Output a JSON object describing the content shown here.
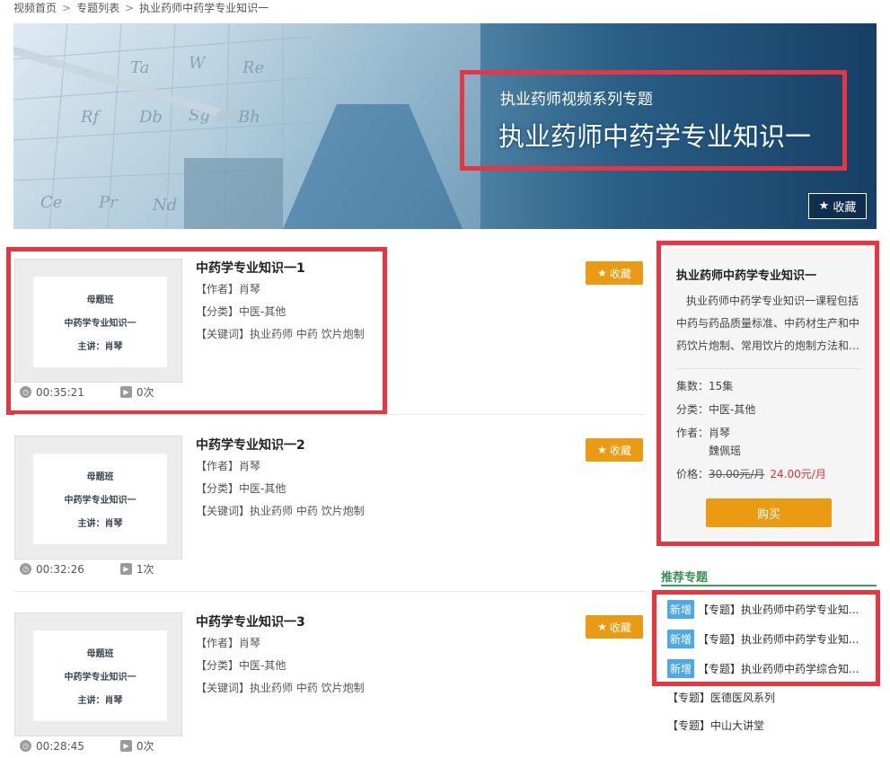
{
  "breadcrumb": {
    "items": [
      "视频首页",
      "专题列表",
      "执业药师中药学专业知识一"
    ],
    "separator": ">"
  },
  "banner": {
    "subtitle": "执业药师视频系列专题",
    "title": "执业药师中药学专业知识一",
    "favorite_label": "收藏",
    "favorite_icon": "star-icon"
  },
  "videos": [
    {
      "title": "中药学专业知识一1",
      "author": "【作者】肖琴",
      "category": "【分类】中医-其他",
      "keywords": "【关键词】执业药师 中药 饮片炮制",
      "duration": "00:35:21",
      "plays": "0次",
      "favorite_label": "收藏",
      "thumb": {
        "line1": "母题班",
        "line2": "中药学专业知识一",
        "line3": "主讲：肖琴"
      }
    },
    {
      "title": "中药学专业知识一2",
      "author": "【作者】肖琴",
      "category": "【分类】中医-其他",
      "keywords": "【关键词】执业药师 中药 饮片炮制",
      "duration": "00:32:26",
      "plays": "1次",
      "favorite_label": "收藏",
      "thumb": {
        "line1": "母题班",
        "line2": "中药学专业知识一",
        "line3": "主讲：肖琴"
      }
    },
    {
      "title": "中药学专业知识一3",
      "author": "【作者】肖琴",
      "category": "【分类】中医-其他",
      "keywords": "【关键词】执业药师 中药 饮片炮制",
      "duration": "00:28:45",
      "plays": "0次",
      "favorite_label": "收藏",
      "thumb": {
        "line1": "母题班",
        "line2": "中药学专业知识一",
        "line3": "主讲：肖琴"
      }
    }
  ],
  "sidebar": {
    "title": "执业药师中药学专业知识一",
    "description": "执业药师中药学专业知识一课程包括中药与药品质量标准、中药材生产和中药饮片炮制、常用饮片的炮制方法和…",
    "episodes": "集数：15集",
    "category": "分类：中医-其他",
    "author_label": "作者：肖琴",
    "author_2": "魏佩瑶",
    "price_label": "价格：",
    "old_price": "30.00元/月",
    "new_price": "24.00元/月",
    "buy_label": "购买"
  },
  "recommend": {
    "heading": "推荐专题",
    "items": [
      {
        "badge": "新增",
        "text": "【专题】执业药师中药学专业知..."
      },
      {
        "badge": "新增",
        "text": "【专题】执业药师中药学专业知..."
      },
      {
        "badge": "新增",
        "text": "【专题】执业药师中药学综合知..."
      },
      {
        "badge": "",
        "text": "【专题】医德医风系列"
      },
      {
        "badge": "",
        "text": "【专题】中山大讲堂"
      }
    ]
  },
  "colors": {
    "accent_orange": "#ea9a13",
    "highlight_red": "#ea3440",
    "new_badge": "#4fa9e8",
    "recommend_green": "#3a8f55",
    "sale_price": "#e23030"
  }
}
